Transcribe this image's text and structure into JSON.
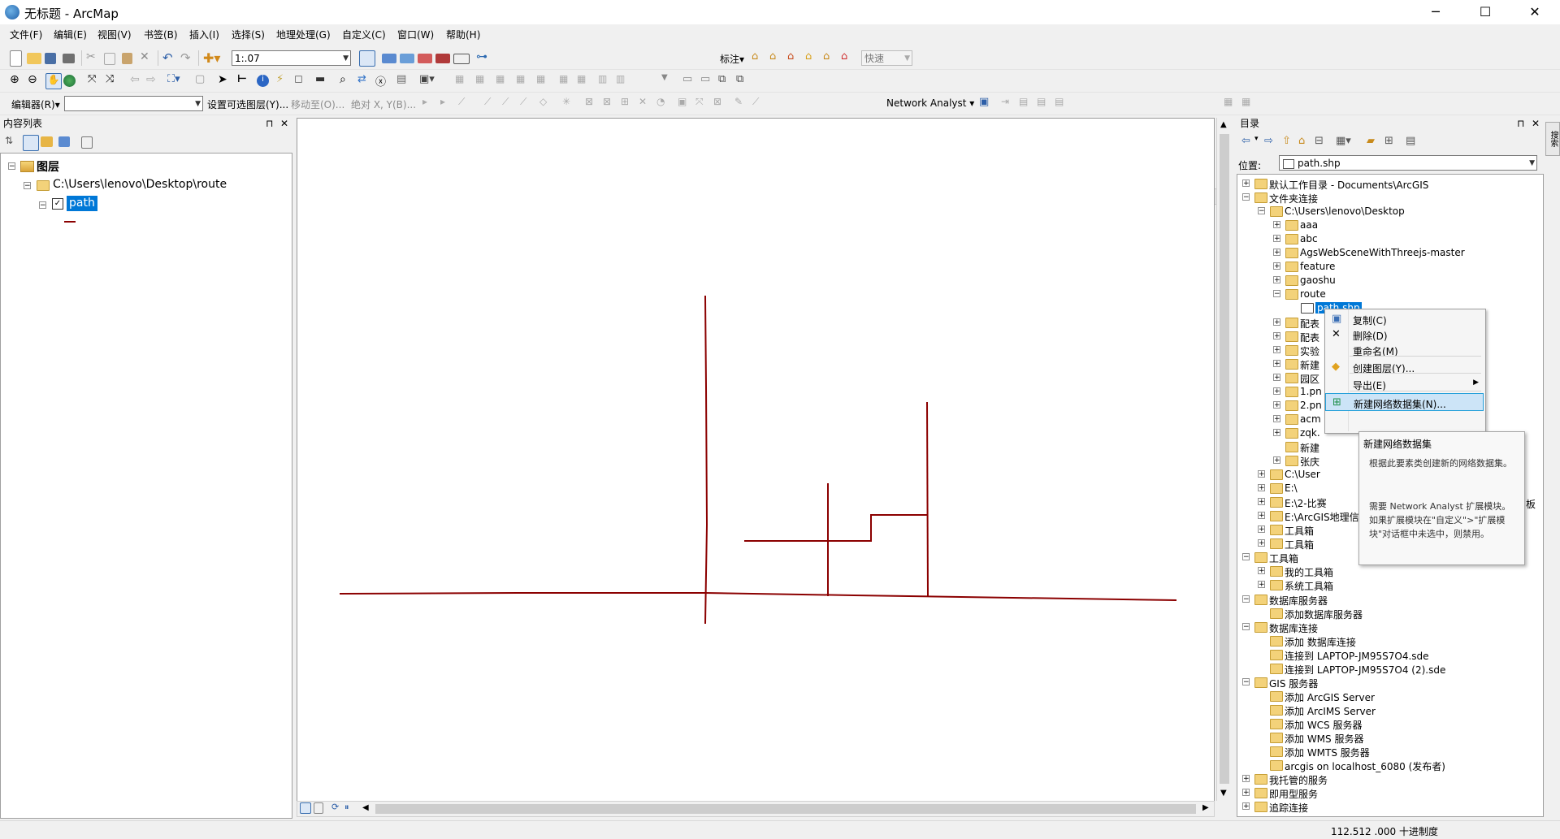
{
  "window": {
    "title": "无标题 - ArcMap",
    "minimize": "─",
    "maximize": "☐",
    "close": "✕"
  },
  "menu": [
    "文件(F)",
    "编辑(E)",
    "视图(V)",
    "书签(B)",
    "插入(I)",
    "选择(S)",
    "地理处理(G)",
    "自定义(C)",
    "窗口(W)",
    "帮助(H)"
  ],
  "toolbar": {
    "scale": "1:.07",
    "label_menu": "标注▾",
    "quick_mode": "快速"
  },
  "editor_toolbar": {
    "editor": "编辑器(R)▾",
    "set_selectable": "设置可选图层(Y)...",
    "move_to": "移动至(O)...",
    "absolute_xy": "绝对 X, Y(B)...",
    "network_analyst": "Network Analyst ▾"
  },
  "toc": {
    "title": "内容列表",
    "layers_root": "图层",
    "folder": "C:\\Users\\lenovo\\Desktop\\route",
    "layer": "path",
    "pin": "⊓",
    "close": "✕"
  },
  "catalog": {
    "title": "目录",
    "location_label": "位置:",
    "location_value": "path.shp",
    "side_tab": "搜索",
    "tree": [
      {
        "label": "默认工作目录 - Documents\\ArcGIS",
        "level": 0,
        "exp": "+"
      },
      {
        "label": "文件夹连接",
        "level": 0,
        "exp": "−"
      },
      {
        "label": "C:\\Users\\lenovo\\Desktop",
        "level": 1,
        "exp": "−"
      },
      {
        "label": "aaa",
        "level": 2,
        "exp": "+"
      },
      {
        "label": "abc",
        "level": 2,
        "exp": "+"
      },
      {
        "label": "AgsWebSceneWithThreejs-master",
        "level": 2,
        "exp": "+"
      },
      {
        "label": "feature",
        "level": 2,
        "exp": "+"
      },
      {
        "label": "gaoshu",
        "level": 2,
        "exp": "+"
      },
      {
        "label": "route",
        "level": 2,
        "exp": "−"
      },
      {
        "label": "path.shp",
        "level": 3,
        "exp": "",
        "selected": true
      },
      {
        "label": "配表",
        "level": 2,
        "exp": "+"
      },
      {
        "label": "配表",
        "level": 2,
        "exp": "+"
      },
      {
        "label": "实验",
        "level": 2,
        "exp": "+"
      },
      {
        "label": "新建",
        "level": 2,
        "exp": "+"
      },
      {
        "label": "园区",
        "level": 2,
        "exp": "+"
      },
      {
        "label": "1.pn",
        "level": 2,
        "exp": "+"
      },
      {
        "label": "2.pn",
        "level": 2,
        "exp": "+"
      },
      {
        "label": "acm",
        "level": 2,
        "exp": "+"
      },
      {
        "label": "zqk.",
        "level": 2,
        "exp": "+"
      },
      {
        "label": "新建",
        "level": 2,
        "exp": ""
      },
      {
        "label": "张庆",
        "level": 2,
        "exp": "+"
      },
      {
        "label": "C:\\User",
        "level": 1,
        "exp": "+"
      },
      {
        "label": "E:\\",
        "level": 1,
        "exp": "+"
      },
      {
        "label": "E:\\2-比赛",
        "level": 1,
        "exp": "+"
      },
      {
        "label": "E:\\ArcGIS地理信",
        "level": 1,
        "exp": "+"
      },
      {
        "label": "工具箱",
        "level": 1,
        "exp": "+"
      },
      {
        "label": "工具箱",
        "level": 1,
        "exp": "+"
      },
      {
        "label": "工具箱",
        "level": 0,
        "exp": "−"
      },
      {
        "label": "我的工具箱",
        "level": 1,
        "exp": "+"
      },
      {
        "label": "系统工具箱",
        "level": 1,
        "exp": "+"
      },
      {
        "label": "数据库服务器",
        "level": 0,
        "exp": "−"
      },
      {
        "label": "添加数据库服务器",
        "level": 1,
        "exp": ""
      },
      {
        "label": "数据库连接",
        "level": 0,
        "exp": "−"
      },
      {
        "label": "添加 数据库连接",
        "level": 1,
        "exp": ""
      },
      {
        "label": "连接到 LAPTOP-JM95S7O4.sde",
        "level": 1,
        "exp": ""
      },
      {
        "label": "连接到 LAPTOP-JM95S7O4 (2).sde",
        "level": 1,
        "exp": ""
      },
      {
        "label": "GIS 服务器",
        "level": 0,
        "exp": "−"
      },
      {
        "label": "添加 ArcGIS Server",
        "level": 1,
        "exp": ""
      },
      {
        "label": "添加 ArcIMS Server",
        "level": 1,
        "exp": ""
      },
      {
        "label": "添加 WCS 服务器",
        "level": 1,
        "exp": ""
      },
      {
        "label": "添加 WMS 服务器",
        "level": 1,
        "exp": ""
      },
      {
        "label": "添加 WMTS 服务器",
        "level": 1,
        "exp": ""
      },
      {
        "label": "arcgis on localhost_6080 (发布者)",
        "level": 1,
        "exp": ""
      },
      {
        "label": "我托管的服务",
        "level": 0,
        "exp": "+"
      },
      {
        "label": "即用型服务",
        "level": 0,
        "exp": "+"
      },
      {
        "label": "追踪连接",
        "level": 0,
        "exp": "+"
      }
    ]
  },
  "context_menu": [
    {
      "label": "复制(C)",
      "icon": "copy-icon"
    },
    {
      "label": "删除(D)",
      "icon": "delete-icon"
    },
    {
      "label": "重命名(M)",
      "icon": ""
    },
    {
      "label": "创建图层(Y)...",
      "icon": "layer-icon"
    },
    {
      "label": "导出(E)",
      "icon": "",
      "submenu": true
    },
    {
      "label": "新建网络数据集(N)...",
      "icon": "network-dataset-icon",
      "highlight": true
    }
  ],
  "tooltip": {
    "title": "新建网络数据集",
    "desc": "根据此要素类创建新的网络数据集。",
    "requires": "需要 Network Analyst 扩展模块。如果扩展模块在\"自定义\">\"扩展模块\"对话框中未选中，则禁用。"
  },
  "side_clip": "板",
  "status": {
    "coords": "112.512  .000 十进制度"
  },
  "colors": {
    "line": "#8b0000",
    "selection": "#0078d7"
  }
}
